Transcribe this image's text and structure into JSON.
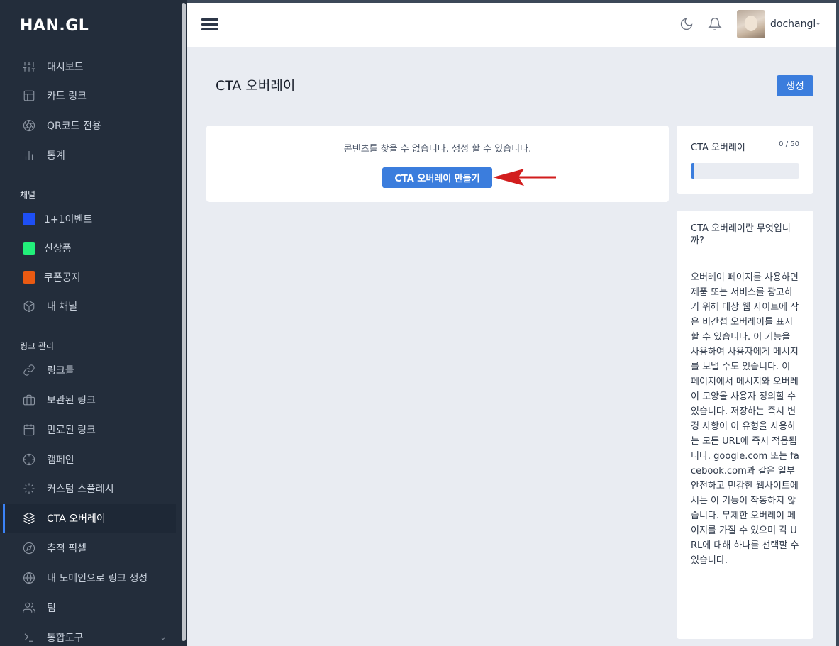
{
  "brand": "HAN.GL",
  "sidebar": {
    "main": [
      {
        "label": "대시보드",
        "icon": "sliders-icon"
      },
      {
        "label": "카드 링크",
        "icon": "layout-icon"
      },
      {
        "label": "QR코드 전용",
        "icon": "aperture-icon"
      },
      {
        "label": "통계",
        "icon": "bar-chart-icon"
      }
    ],
    "channels_label": "채널",
    "channels": [
      {
        "label": "1+1이벤트",
        "color": "#1e4ff5"
      },
      {
        "label": "신상품",
        "color": "#22f07a"
      },
      {
        "label": "쿠폰공지",
        "color": "#ea5a12"
      },
      {
        "label": "내 채널",
        "icon": "box-icon"
      }
    ],
    "links_label": "링크 관리",
    "links": [
      {
        "label": "링크들",
        "icon": "link-icon"
      },
      {
        "label": "보관된 링크",
        "icon": "briefcase-icon"
      },
      {
        "label": "만료된 링크",
        "icon": "calendar-icon"
      },
      {
        "label": "캠페인",
        "icon": "crosshair-icon"
      },
      {
        "label": "커스텀 스플레시",
        "icon": "loader-icon"
      },
      {
        "label": "CTA 오버레이",
        "icon": "layers-icon"
      },
      {
        "label": "추적 픽셀",
        "icon": "compass-icon"
      },
      {
        "label": "내 도메인으로 링크 생성",
        "icon": "globe-icon"
      },
      {
        "label": "팀",
        "icon": "users-icon"
      },
      {
        "label": "통합도구",
        "icon": "terminal-icon"
      }
    ]
  },
  "header": {
    "username": "dochangl"
  },
  "page": {
    "title": "CTA 오버레이",
    "create_label": "생성",
    "empty_message": "콘텐츠를 찾을 수 없습니다. 생성 할 수 있습니다.",
    "make_label": "CTA 오버레이 만들기"
  },
  "usage": {
    "title": "CTA 오버레이",
    "count": "0 / 50",
    "fraction": 0
  },
  "info": {
    "title": "CTA 오버레이란 무엇입니까?",
    "body": "오버레이 페이지를 사용하면 제품 또는 서비스를 광고하기 위해 대상 웹 사이트에 작은 비간섭 오버레이를 표시할 수 있습니다. 이 기능을 사용하여 사용자에게 메시지를 보낼 수도 있습니다. 이 페이지에서 메시지와 오버레이 모양을 사용자 정의할 수 있습니다. 저장하는 즉시 변경 사항이 이 유형을 사용하는 모든 URL에 즉시 적용됩니다. google.com 또는 facebook.com과 같은 일부 안전하고 민감한 웹사이트에서는 이 기능이 작동하지 않습니다. 무제한 오버레이 페이지를 가질 수 있으며 각 URL에 대해 하나를 선택할 수 있습니다."
  }
}
